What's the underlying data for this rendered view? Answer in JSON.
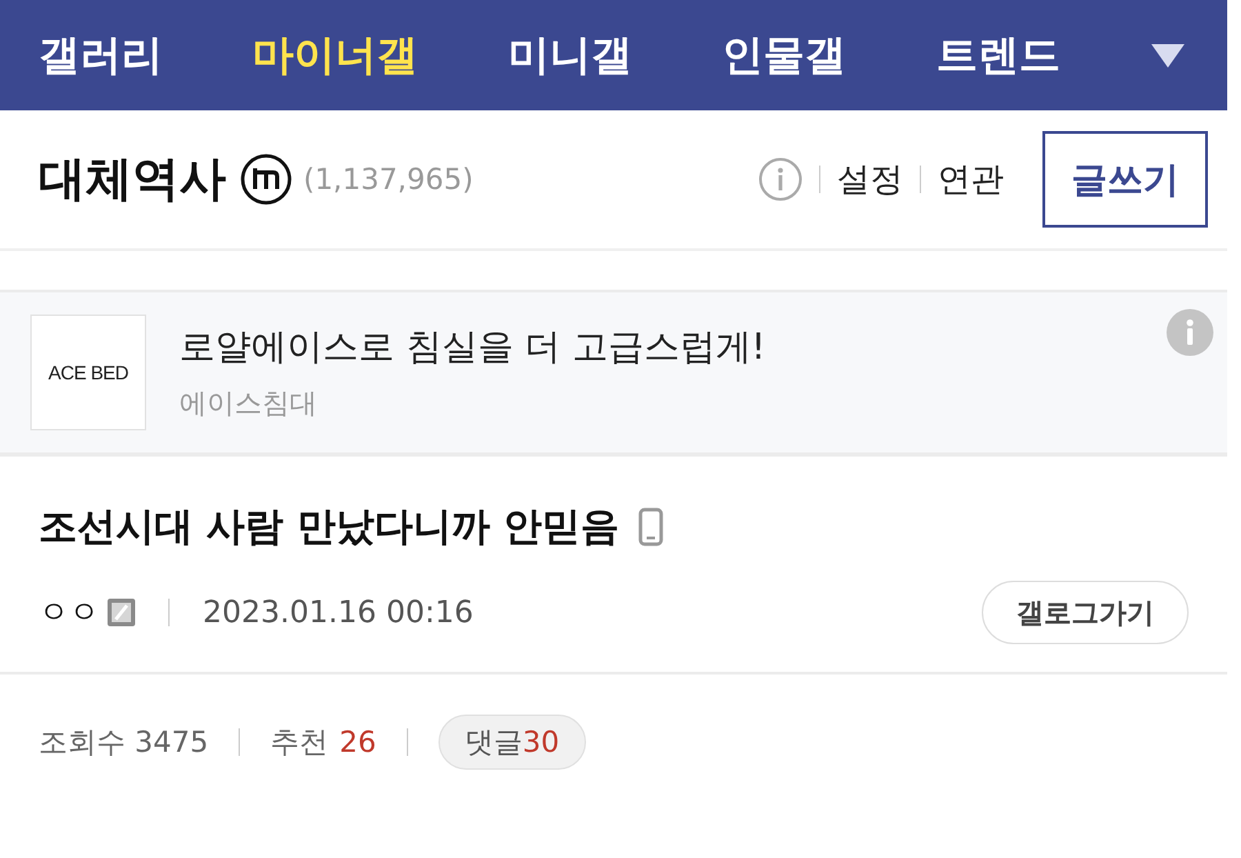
{
  "nav": {
    "tabs": [
      {
        "label": "갤러리",
        "selected": false
      },
      {
        "label": "마이너갤",
        "selected": true
      },
      {
        "label": "미니갤",
        "selected": false
      },
      {
        "label": "인물갤",
        "selected": false
      },
      {
        "label": "트렌드",
        "selected": false
      }
    ]
  },
  "gallery": {
    "name": "대체역사",
    "count": "(1,137,965)",
    "links": [
      "설정",
      "연관"
    ],
    "write_button": "글쓰기"
  },
  "ad": {
    "logo": "ACE BED",
    "headline": "로얄에이스로 침실을 더 고급스럽게!",
    "advertiser": "에이스침대"
  },
  "post": {
    "title": "조선시대 사람 만났다니까 안믿음",
    "from_mobile": true,
    "author": "ㅇㅇ",
    "date": "2023.01.16 00:16",
    "gallog_button": "갤로그가기",
    "stats": {
      "views_label": "조회수",
      "views": "3475",
      "recommend_label": "추천",
      "recommend": "26",
      "comments_label": "댓글",
      "comments": "30"
    }
  }
}
